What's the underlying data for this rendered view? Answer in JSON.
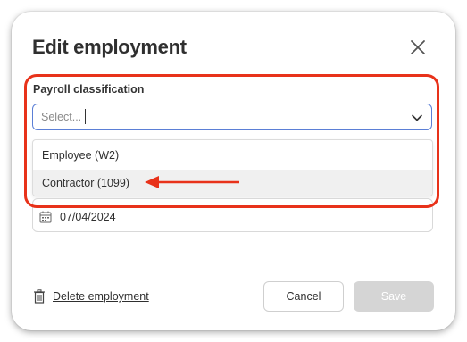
{
  "dialog": {
    "title": "Edit employment"
  },
  "payroll": {
    "label": "Payroll classification",
    "placeholder": "Select...",
    "options": [
      {
        "label": "Employee (W2)"
      },
      {
        "label": "Contractor (1099)"
      }
    ]
  },
  "start_date": {
    "value": "07/04/2024"
  },
  "footer": {
    "delete_label": "Delete employment",
    "cancel_label": "Cancel",
    "save_label": "Save"
  },
  "colors": {
    "accent_focus": "#5b7fd6",
    "annotation_red": "#e8321a",
    "disabled_button": "#d5d5d5"
  },
  "icons": [
    "close-icon",
    "chevron-down-icon",
    "calendar-icon",
    "trash-icon"
  ]
}
